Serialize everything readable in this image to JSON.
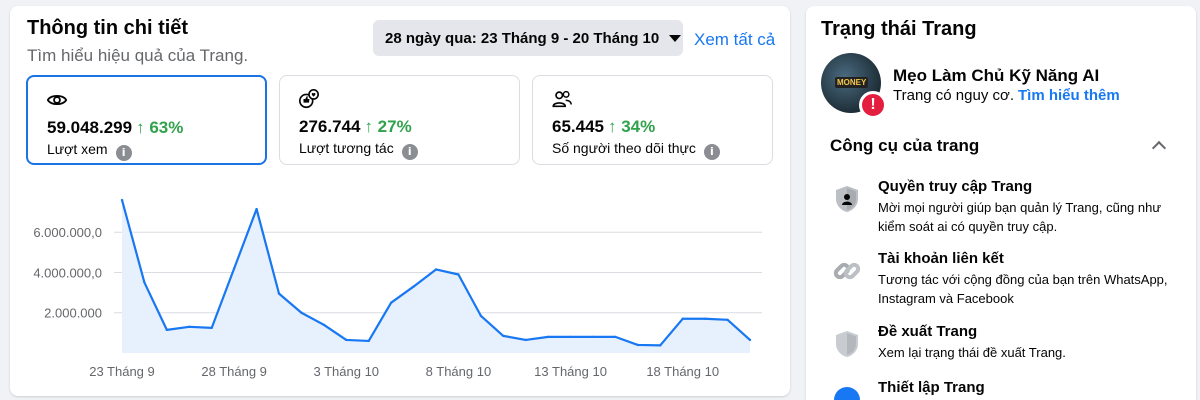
{
  "insights": {
    "title": "Thông tin chi tiết",
    "subtitle": "Tìm hiểu hiệu quả của Trang.",
    "date_range": "28 ngày qua: 23 Tháng 9 - 20 Tháng 10",
    "see_all": "Xem tất cả",
    "metrics": [
      {
        "icon": "eye-icon",
        "value": "59.048.299",
        "delta": "↑ 63%",
        "label": "Lượt xem",
        "selected": true
      },
      {
        "icon": "reactions-icon",
        "value": "276.744",
        "delta": "↑ 27%",
        "label": "Lượt tương tác",
        "selected": false
      },
      {
        "icon": "people-icon",
        "value": "65.445",
        "delta": "↑ 34%",
        "label": "Số người theo dõi thực",
        "selected": false
      }
    ],
    "info_glyph": "i"
  },
  "chart_data": {
    "type": "area",
    "x": [
      "23 Tháng 9",
      "24 Tháng 9",
      "25 Tháng 9",
      "26 Tháng 9",
      "27 Tháng 9",
      "28 Tháng 9",
      "29 Tháng 9",
      "30 Tháng 9",
      "1 Tháng 10",
      "2 Tháng 10",
      "3 Tháng 10",
      "4 Tháng 10",
      "5 Tháng 10",
      "6 Tháng 10",
      "7 Tháng 10",
      "8 Tháng 10",
      "9 Tháng 10",
      "10 Tháng 10",
      "11 Tháng 10",
      "12 Tháng 10",
      "13 Tháng 10",
      "14 Tháng 10",
      "15 Tháng 10",
      "16 Tháng 10",
      "17 Tháng 10",
      "18 Tháng 10",
      "19 Tháng 10",
      "20 Tháng 10"
    ],
    "xticks": [
      "23 Tháng 9",
      "28 Tháng 9",
      "3 Tháng 10",
      "8 Tháng 10",
      "13 Tháng 10",
      "18 Tháng 10"
    ],
    "yticks": [
      {
        "value": 2000000,
        "label": "2.000.000"
      },
      {
        "value": 4000000,
        "label": "4.000.000,0"
      },
      {
        "value": 6000000,
        "label": "6.000.000,0"
      }
    ],
    "ylim": [
      0,
      7800000
    ],
    "values": [
      7600000,
      3500000,
      1150000,
      1300000,
      1250000,
      4200000,
      7150000,
      2950000,
      2000000,
      1400000,
      650000,
      600000,
      2500000,
      3300000,
      4150000,
      3900000,
      1850000,
      850000,
      650000,
      800000,
      800000,
      800000,
      800000,
      400000,
      380000,
      1700000,
      1700000,
      1650000,
      650000
    ],
    "line_color": "#1877f2",
    "fill_color": "#e7f0fd",
    "grid": true
  },
  "page_status": {
    "title": "Trạng thái Trang",
    "avatar_text": "MONEY",
    "warning_glyph": "!",
    "page_name": "Mẹo Làm Chủ Kỹ Năng AI",
    "status_text": "Trang có nguy cơ.",
    "learn_more": "Tìm hiểu thêm",
    "tools_heading": "Công cụ của trang",
    "tools": [
      {
        "name": "Quyền truy cập Trang",
        "desc": "Mời mọi người giúp bạn quản lý Trang, cũng như kiểm soát ai có quyền truy cập."
      },
      {
        "name": "Tài khoản liên kết",
        "desc": "Tương tác với cộng đồng của bạn trên WhatsApp, Instagram và Facebook"
      },
      {
        "name": "Đề xuất Trang",
        "desc": "Xem lại trạng thái đề xuất Trang."
      },
      {
        "name": "Thiết lập Trang",
        "desc": ""
      }
    ]
  },
  "colors": {
    "accent": "#1877f2",
    "positive": "#31a24c",
    "danger": "#e41e3f"
  }
}
